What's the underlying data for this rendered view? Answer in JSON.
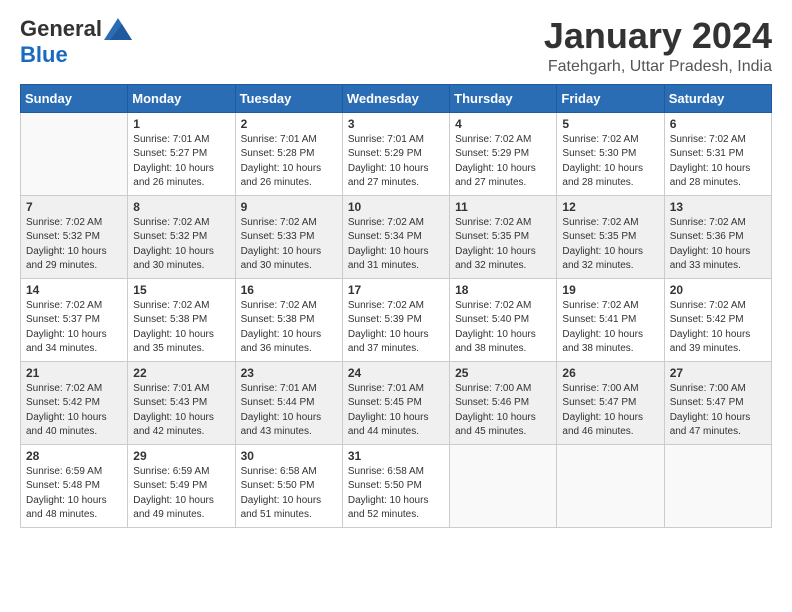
{
  "logo": {
    "general": "General",
    "blue": "Blue"
  },
  "header": {
    "title": "January 2024",
    "subtitle": "Fatehgarh, Uttar Pradesh, India"
  },
  "days_of_week": [
    "Sunday",
    "Monday",
    "Tuesday",
    "Wednesday",
    "Thursday",
    "Friday",
    "Saturday"
  ],
  "weeks": [
    [
      {
        "day": "",
        "info": ""
      },
      {
        "day": "1",
        "info": "Sunrise: 7:01 AM\nSunset: 5:27 PM\nDaylight: 10 hours\nand 26 minutes."
      },
      {
        "day": "2",
        "info": "Sunrise: 7:01 AM\nSunset: 5:28 PM\nDaylight: 10 hours\nand 26 minutes."
      },
      {
        "day": "3",
        "info": "Sunrise: 7:01 AM\nSunset: 5:29 PM\nDaylight: 10 hours\nand 27 minutes."
      },
      {
        "day": "4",
        "info": "Sunrise: 7:02 AM\nSunset: 5:29 PM\nDaylight: 10 hours\nand 27 minutes."
      },
      {
        "day": "5",
        "info": "Sunrise: 7:02 AM\nSunset: 5:30 PM\nDaylight: 10 hours\nand 28 minutes."
      },
      {
        "day": "6",
        "info": "Sunrise: 7:02 AM\nSunset: 5:31 PM\nDaylight: 10 hours\nand 28 minutes."
      }
    ],
    [
      {
        "day": "7",
        "info": "Sunrise: 7:02 AM\nSunset: 5:32 PM\nDaylight: 10 hours\nand 29 minutes."
      },
      {
        "day": "8",
        "info": "Sunrise: 7:02 AM\nSunset: 5:32 PM\nDaylight: 10 hours\nand 30 minutes."
      },
      {
        "day": "9",
        "info": "Sunrise: 7:02 AM\nSunset: 5:33 PM\nDaylight: 10 hours\nand 30 minutes."
      },
      {
        "day": "10",
        "info": "Sunrise: 7:02 AM\nSunset: 5:34 PM\nDaylight: 10 hours\nand 31 minutes."
      },
      {
        "day": "11",
        "info": "Sunrise: 7:02 AM\nSunset: 5:35 PM\nDaylight: 10 hours\nand 32 minutes."
      },
      {
        "day": "12",
        "info": "Sunrise: 7:02 AM\nSunset: 5:35 PM\nDaylight: 10 hours\nand 32 minutes."
      },
      {
        "day": "13",
        "info": "Sunrise: 7:02 AM\nSunset: 5:36 PM\nDaylight: 10 hours\nand 33 minutes."
      }
    ],
    [
      {
        "day": "14",
        "info": "Sunrise: 7:02 AM\nSunset: 5:37 PM\nDaylight: 10 hours\nand 34 minutes."
      },
      {
        "day": "15",
        "info": "Sunrise: 7:02 AM\nSunset: 5:38 PM\nDaylight: 10 hours\nand 35 minutes."
      },
      {
        "day": "16",
        "info": "Sunrise: 7:02 AM\nSunset: 5:38 PM\nDaylight: 10 hours\nand 36 minutes."
      },
      {
        "day": "17",
        "info": "Sunrise: 7:02 AM\nSunset: 5:39 PM\nDaylight: 10 hours\nand 37 minutes."
      },
      {
        "day": "18",
        "info": "Sunrise: 7:02 AM\nSunset: 5:40 PM\nDaylight: 10 hours\nand 38 minutes."
      },
      {
        "day": "19",
        "info": "Sunrise: 7:02 AM\nSunset: 5:41 PM\nDaylight: 10 hours\nand 38 minutes."
      },
      {
        "day": "20",
        "info": "Sunrise: 7:02 AM\nSunset: 5:42 PM\nDaylight: 10 hours\nand 39 minutes."
      }
    ],
    [
      {
        "day": "21",
        "info": "Sunrise: 7:02 AM\nSunset: 5:42 PM\nDaylight: 10 hours\nand 40 minutes."
      },
      {
        "day": "22",
        "info": "Sunrise: 7:01 AM\nSunset: 5:43 PM\nDaylight: 10 hours\nand 42 minutes."
      },
      {
        "day": "23",
        "info": "Sunrise: 7:01 AM\nSunset: 5:44 PM\nDaylight: 10 hours\nand 43 minutes."
      },
      {
        "day": "24",
        "info": "Sunrise: 7:01 AM\nSunset: 5:45 PM\nDaylight: 10 hours\nand 44 minutes."
      },
      {
        "day": "25",
        "info": "Sunrise: 7:00 AM\nSunset: 5:46 PM\nDaylight: 10 hours\nand 45 minutes."
      },
      {
        "day": "26",
        "info": "Sunrise: 7:00 AM\nSunset: 5:47 PM\nDaylight: 10 hours\nand 46 minutes."
      },
      {
        "day": "27",
        "info": "Sunrise: 7:00 AM\nSunset: 5:47 PM\nDaylight: 10 hours\nand 47 minutes."
      }
    ],
    [
      {
        "day": "28",
        "info": "Sunrise: 6:59 AM\nSunset: 5:48 PM\nDaylight: 10 hours\nand 48 minutes."
      },
      {
        "day": "29",
        "info": "Sunrise: 6:59 AM\nSunset: 5:49 PM\nDaylight: 10 hours\nand 49 minutes."
      },
      {
        "day": "30",
        "info": "Sunrise: 6:58 AM\nSunset: 5:50 PM\nDaylight: 10 hours\nand 51 minutes."
      },
      {
        "day": "31",
        "info": "Sunrise: 6:58 AM\nSunset: 5:50 PM\nDaylight: 10 hours\nand 52 minutes."
      },
      {
        "day": "",
        "info": ""
      },
      {
        "day": "",
        "info": ""
      },
      {
        "day": "",
        "info": ""
      }
    ]
  ]
}
